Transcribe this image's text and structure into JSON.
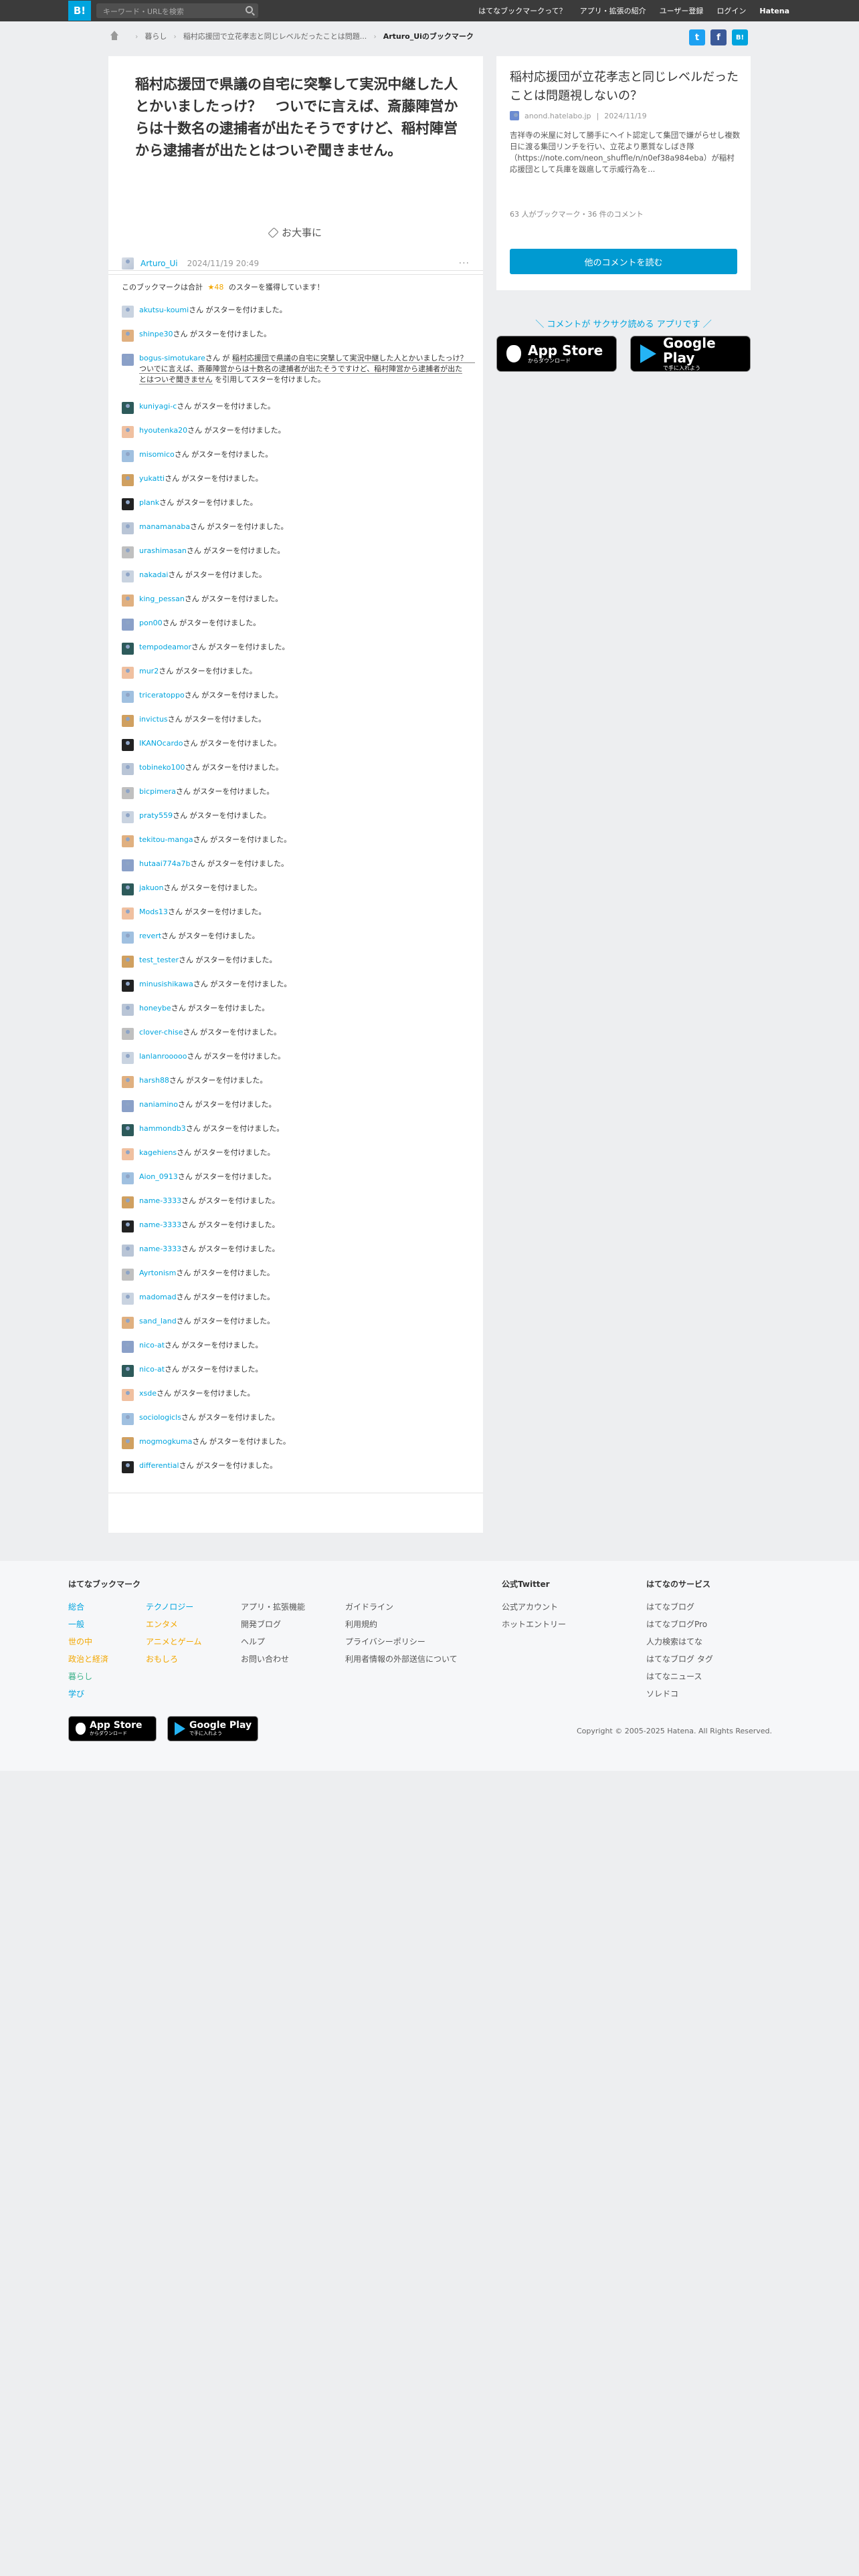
{
  "topbar": {
    "logo": "B!",
    "search_placeholder": "キーワード・URLを検索",
    "nav": [
      "はてなブックマークって？",
      "アプリ・拡張の紹介",
      "ユーザー登録",
      "ログイン"
    ],
    "brand": "Hatena"
  },
  "breadcrumb": {
    "items": [
      "暮らし",
      "稲村応援団で立花孝志と同じレベルだったことは問題..."
    ],
    "current": "Arturo_Uiのブックマーク"
  },
  "share": [
    "t",
    "f",
    "B!"
  ],
  "entry": {
    "title": "稲村応援団で県議の自宅に突撃して実況中継した人とかいましたっけ？　ついでに言えば、斎藤陣営からは十数名の逮捕者が出たそうですけど、稲村陣営から逮捕者が出たとはついぞ聞きません。",
    "daiji": "お大事に",
    "author": "Arturo_Ui",
    "date": "2024/11/19 20:49",
    "more": "···"
  },
  "stars": {
    "prefix": "このブックマークは合計",
    "count": "★48",
    "suffix": "のスターを獲得しています！",
    "suffix_text": "さん がスターを付けました。",
    "quote_pre": "さん が",
    "quote": "稲村応援団で県議の自宅に突撃して実況中継した人とかいましたっけ？　ついでに言えば、斎藤陣営からは十数名の逮捕者が出たそうですけど、稲村陣営から逮捕者が出たとはついぞ聞きません",
    "quote_post": "を引用してスターを付けました。",
    "users": [
      "akutsu-koumi",
      "shinpe30",
      "bogus-simotukare",
      "kuniyagi-c",
      "hyoutenka20",
      "misomico",
      "yukatti",
      "plank",
      "manamanaba",
      "urashimasan",
      "nakadai",
      "king_pessan",
      "pon00",
      "tempodeamor",
      "mur2",
      "triceratoppo",
      "invictus",
      "IKANOcardo",
      "tobineko100",
      "bicpimera",
      "praty559",
      "tekitou-manga",
      "hutaai774a7b",
      "jakuon",
      "Mods13",
      "revert",
      "test_tester",
      "minusishikawa",
      "honeybe",
      "clover-chise",
      "lanlanrooooo",
      "harsh88",
      "naniamino",
      "hammondb3",
      "kagehiens",
      "Aion_0913",
      "name-3333",
      "name-3333",
      "name-3333",
      "Ayrtonism",
      "madomad",
      "sand_land",
      "nico-at",
      "nico-at",
      "xsde",
      "sociologicls",
      "mogmogkuma",
      "differential"
    ]
  },
  "side": {
    "title": "稲村応援団が立花孝志と同じレベルだったことは問題視しないの？",
    "site": "anond.hatelabo.jp",
    "date": "2024/11/19",
    "desc": "吉祥寺の米屋に対して勝手にヘイト認定して集団で嫌がらせし複数日に渡る集団リンチを行い、立花より悪質なしばき隊（https://note.com/neon_shuffle/n/n0ef38a984eba）が稲村応援団として兵庫を跋扈して示威行為を...",
    "counts": "63 人がブックマーク・36 件のコメント",
    "button": "他のコメントを読む"
  },
  "app": {
    "promo": "＼ コメントが サクサク読める アプリです ／",
    "appstore_small": "からダウンロード",
    "appstore_big": "App Store",
    "play_small": "で手に入れよう",
    "play_big": "Google Play"
  },
  "footer": {
    "heading": "はてなブックマーク",
    "col1": [
      "総合",
      "一般",
      "世の中",
      "政治と経済",
      "暮らし",
      "学び"
    ],
    "col2": [
      "テクノロジー",
      "エンタメ",
      "アニメとゲーム",
      "おもしろ"
    ],
    "col3": [
      "アプリ・拡張機能",
      "開発ブログ",
      "ヘルプ",
      "お問い合わせ"
    ],
    "col4": [
      "ガイドライン",
      "利用規約",
      "プライバシーポリシー",
      "利用者情報の外部送信について"
    ],
    "twitter_heading": "公式Twitter",
    "twitter": [
      "公式アカウント",
      "ホットエントリー"
    ],
    "services_heading": "はてなのサービス",
    "services": [
      "はてなブログ",
      "はてなブログPro",
      "人力検索はてな",
      "はてなブログ タグ",
      "はてなニュース",
      "ソレドコ"
    ],
    "copyright": "Copyright © 2005-2025 Hatena. All Rights Reserved."
  },
  "colors": {
    "accent": "#00a4de",
    "star": "#f3a700",
    "topbar": "#3b3b3b"
  }
}
